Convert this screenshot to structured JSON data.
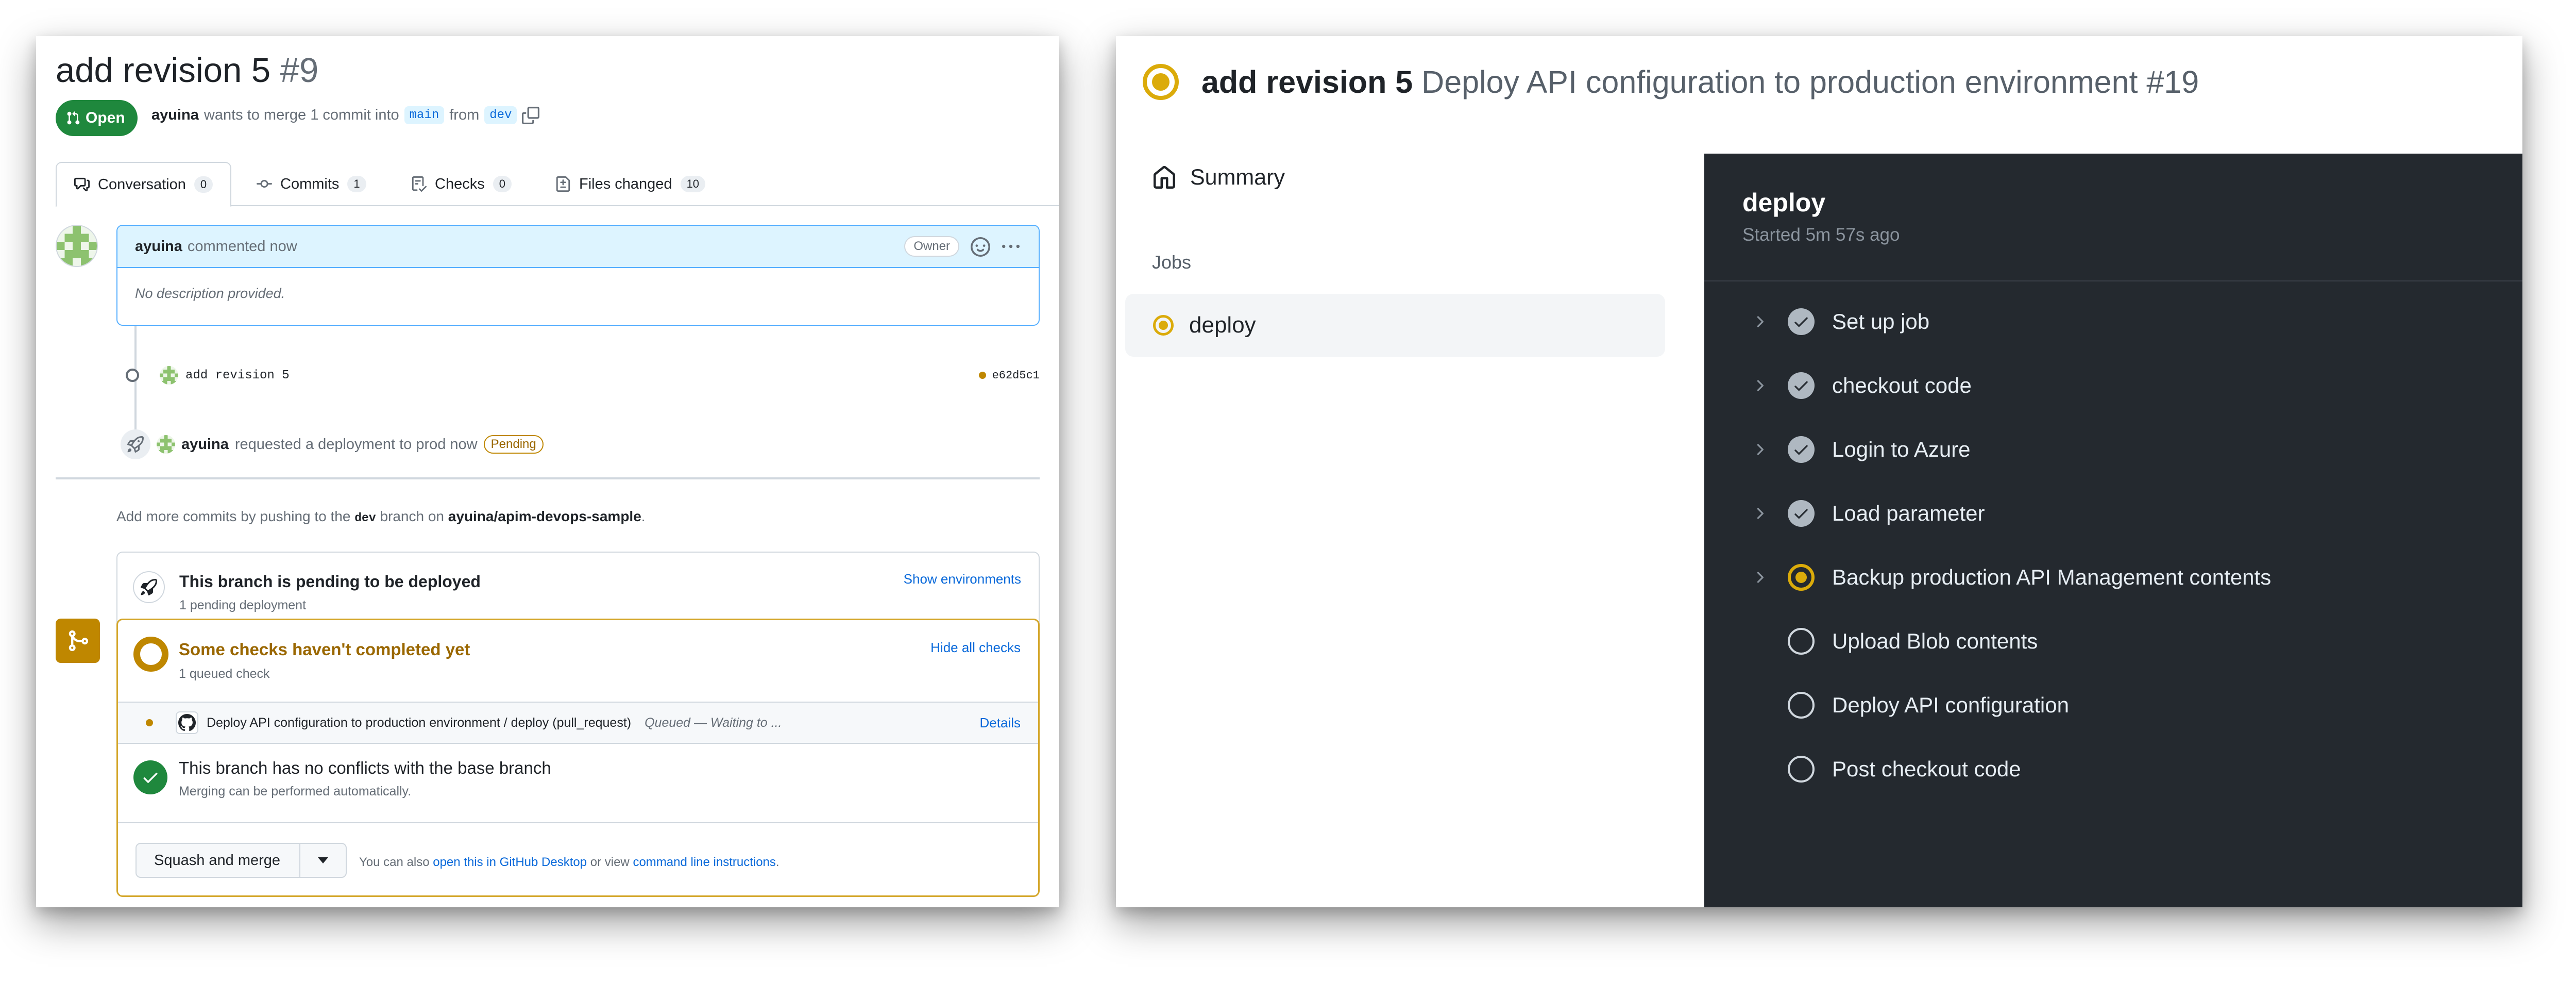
{
  "pull_request": {
    "title": "add revision 5",
    "number": "#9",
    "state": "Open",
    "author": "ayuina",
    "merge_text_1": "wants to merge 1 commit into",
    "base_branch": "main",
    "merge_text_2": "from",
    "head_branch": "dev",
    "tabs": [
      {
        "label": "Conversation",
        "count": "0",
        "icon": "comment-discussion-icon"
      },
      {
        "label": "Commits",
        "count": "1",
        "icon": "git-commit-icon"
      },
      {
        "label": "Checks",
        "count": "0",
        "icon": "checklist-icon"
      },
      {
        "label": "Files changed",
        "count": "10",
        "icon": "file-diff-icon"
      }
    ],
    "comment": {
      "author": "ayuina",
      "action": "commented now",
      "role_badge": "Owner",
      "body": "No description provided."
    },
    "commit": {
      "message": "add revision 5",
      "sha": "e62d5c1",
      "status_color": "#bf8700"
    },
    "deployment_event": {
      "author": "ayuina",
      "text": "requested a deployment to prod now",
      "badge": "Pending"
    },
    "add_commits": {
      "prefix": "Add more commits by pushing to the",
      "branch": "dev",
      "middle": "branch on",
      "repo": "ayuina/apim-devops-sample",
      "suffix": "."
    },
    "environment_box": {
      "title": "This branch is pending to be deployed",
      "subtitle": "1 pending deployment",
      "action": "Show environments"
    },
    "checks": {
      "title": "Some checks haven't completed yet",
      "subtitle": "1 queued check",
      "action": "Hide all checks",
      "rows": [
        {
          "name": "Deploy API configuration to production environment / deploy (pull_request)",
          "status": "Queued — Waiting to ...",
          "action": "Details"
        }
      ]
    },
    "conflicts": {
      "title": "This branch has no conflicts with the base branch",
      "subtitle": "Merging can be performed automatically."
    },
    "merge": {
      "button": "Squash and merge",
      "alt_prefix": "You can also",
      "alt_link1": "open this in GitHub Desktop",
      "alt_middle": "or view",
      "alt_link2": "command line instructions",
      "alt_suffix": "."
    },
    "colors": {
      "open": "#1f883d",
      "pending": "#bf8700",
      "link": "#0969da"
    }
  },
  "workflow_run": {
    "title": "add revision 5",
    "subtitle": "Deploy API configuration to production environment #19",
    "status": "in_progress",
    "sidebar": {
      "summary_label": "Summary",
      "jobs_heading": "Jobs",
      "jobs": [
        {
          "label": "deploy",
          "status": "in_progress"
        }
      ]
    },
    "job_detail": {
      "name": "deploy",
      "started": "Started 5m 57s ago",
      "steps": [
        {
          "label": "Set up job",
          "status": "success",
          "expandable": true
        },
        {
          "label": "checkout code",
          "status": "success",
          "expandable": true
        },
        {
          "label": "Login to Azure",
          "status": "success",
          "expandable": true
        },
        {
          "label": "Load parameter",
          "status": "success",
          "expandable": true
        },
        {
          "label": "Backup production API Management contents",
          "status": "in_progress",
          "expandable": true
        },
        {
          "label": "Upload Blob contents",
          "status": "queued",
          "expandable": false
        },
        {
          "label": "Deploy API configuration",
          "status": "queued",
          "expandable": false
        },
        {
          "label": "Post checkout code",
          "status": "queued",
          "expandable": false
        }
      ]
    },
    "colors": {
      "in_progress": "#dbab0a",
      "dark_bg": "#24292f"
    }
  }
}
